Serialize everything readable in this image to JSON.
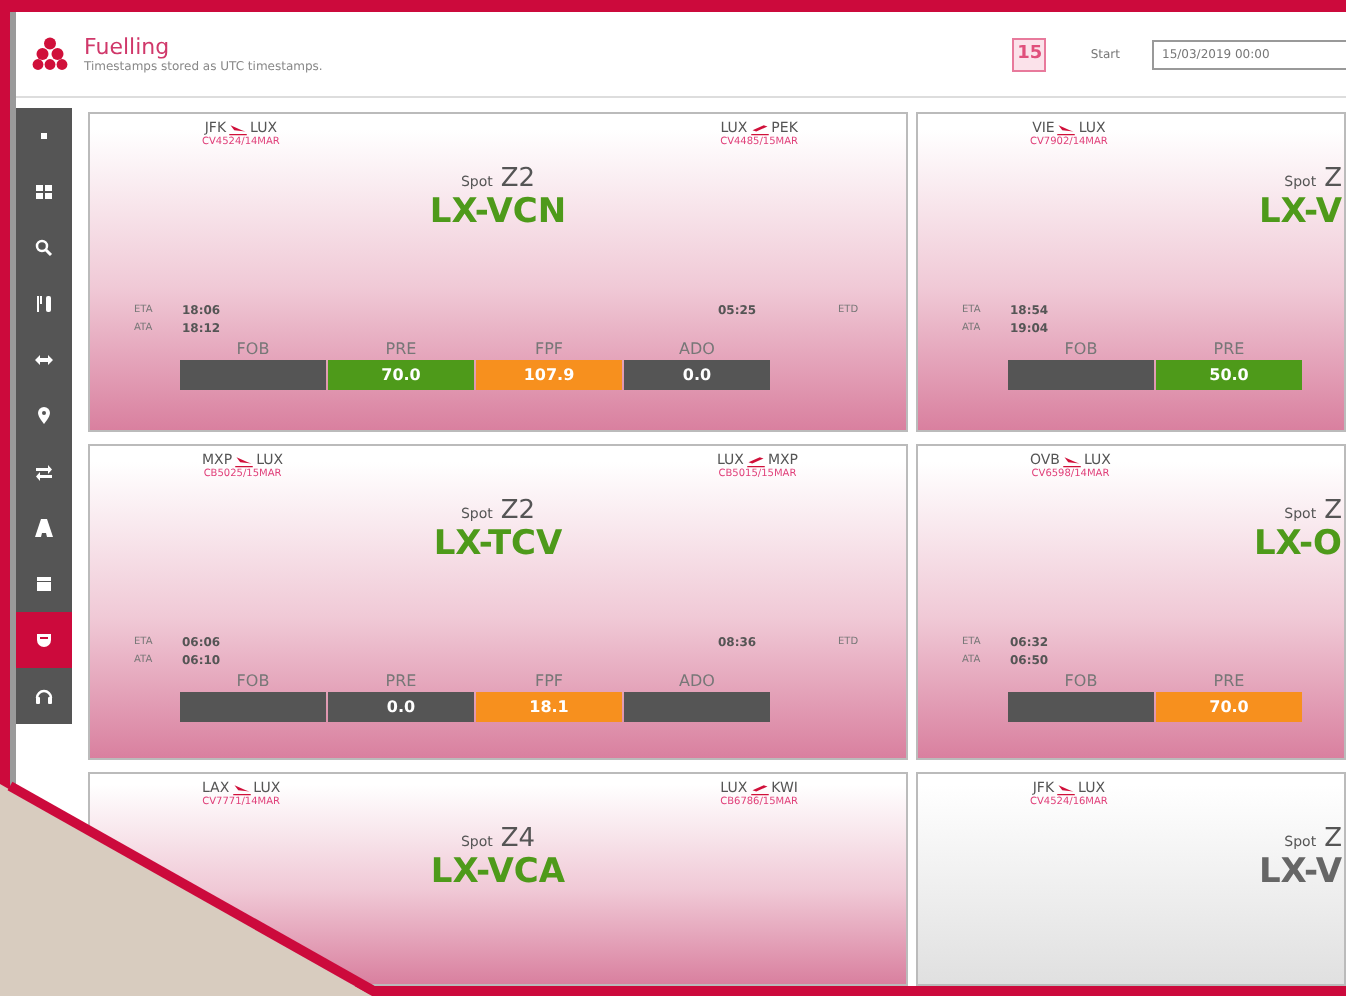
{
  "header": {
    "title": "Fuelling",
    "subtitle": "Timestamps stored as UTC timestamps.",
    "calendar_day": "15",
    "start_label": "Start",
    "start_value": "15/03/2019 00:00"
  },
  "sidebar": {
    "items": [
      {
        "kind": "dot",
        "selected": false
      },
      {
        "kind": "grid",
        "selected": false
      },
      {
        "kind": "search",
        "selected": false
      },
      {
        "kind": "cutlery",
        "selected": false
      },
      {
        "kind": "arrows",
        "selected": false
      },
      {
        "kind": "pin",
        "selected": false
      },
      {
        "kind": "swap",
        "selected": false
      },
      {
        "kind": "road",
        "selected": false
      },
      {
        "kind": "box",
        "selected": false
      },
      {
        "kind": "cup",
        "selected": true
      },
      {
        "kind": "headset",
        "selected": false
      }
    ]
  },
  "cards": [
    {
      "active": true,
      "inbound": {
        "from": "JFK",
        "to": "LUX",
        "flight": "CV4524/14MAR"
      },
      "outbound": {
        "from": "LUX",
        "to": "PEK",
        "flight": "CV4485/15MAR"
      },
      "spot_label": "Spot",
      "spot": "Z2",
      "registration": "LX-VCN",
      "eta_label": "ETA",
      "eta": "18:06",
      "ata_label": "ATA",
      "ata": "18:12",
      "etd": "05:25",
      "etd_label": "ETD",
      "fuel": [
        {
          "label": "FOB",
          "color": "#555555"
        },
        {
          "label": "PRE",
          "value": "70.0",
          "color": "#4e9a1a"
        },
        {
          "label": "FPF",
          "value": "107.9",
          "color": "#f7901e"
        },
        {
          "label": "ADO",
          "value": "0.0",
          "color": "#555555"
        }
      ]
    },
    {
      "active": true,
      "inbound": {
        "from": "VIE",
        "to": "LUX",
        "flight": "CV7902/14MAR"
      },
      "spot_label": "Spot",
      "spot": "Z",
      "registration": "LX-V",
      "eta_label": "ETA",
      "eta": "18:54",
      "ata_label": "ATA",
      "ata": "19:04",
      "fuel": [
        {
          "label": "FOB",
          "color": "#555555"
        },
        {
          "label": "PRE",
          "value": "50.0",
          "color": "#4e9a1a"
        }
      ]
    },
    {
      "active": true,
      "inbound": {
        "from": "MXP",
        "to": "LUX",
        "flight": "CB5025/15MAR"
      },
      "outbound": {
        "from": "LUX",
        "to": "MXP",
        "flight": "CB5015/15MAR"
      },
      "spot_label": "Spot",
      "spot": "Z2",
      "registration": "LX-TCV",
      "eta_label": "ETA",
      "eta": "06:06",
      "ata_label": "ATA",
      "ata": "06:10",
      "etd": "08:36",
      "etd_label": "ETD",
      "fuel": [
        {
          "label": "FOB",
          "color": "#555555"
        },
        {
          "label": "PRE",
          "value": "0.0",
          "color": "#555555"
        },
        {
          "label": "FPF",
          "value": "18.1",
          "color": "#f7901e"
        },
        {
          "label": "ADO",
          "color": "#555555"
        }
      ]
    },
    {
      "active": true,
      "inbound": {
        "from": "OVB",
        "to": "LUX",
        "flight": "CV6598/14MAR"
      },
      "spot_label": "Spot",
      "spot": "Z",
      "registration": "LX-O",
      "eta_label": "ETA",
      "eta": "06:32",
      "ata_label": "ATA",
      "ata": "06:50",
      "fuel": [
        {
          "label": "FOB",
          "color": "#555555"
        },
        {
          "label": "PRE",
          "value": "70.0",
          "color": "#f7901e"
        }
      ]
    },
    {
      "active": true,
      "inbound": {
        "from": "LAX",
        "to": "LUX",
        "flight": "CV7771/14MAR"
      },
      "outbound": {
        "from": "LUX",
        "to": "KWI",
        "flight": "CB6786/15MAR"
      },
      "spot_label": "Spot",
      "spot": "Z4",
      "registration": "LX-VCA"
    },
    {
      "active": false,
      "inbound": {
        "from": "JFK",
        "to": "LUX",
        "flight": "CV4524/16MAR"
      },
      "spot_label": "Spot",
      "spot": "Z",
      "registration": "LX-V"
    }
  ]
}
